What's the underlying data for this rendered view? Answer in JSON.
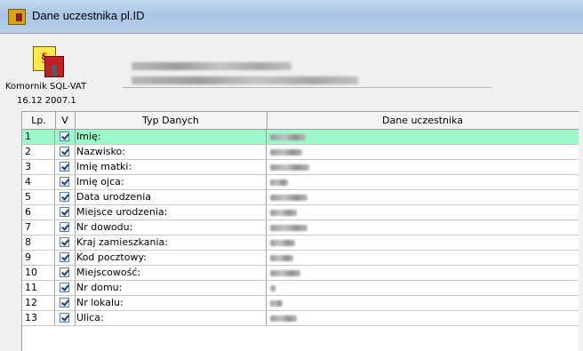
{
  "window": {
    "title": "Dane uczestnika pl.ID"
  },
  "app": {
    "name": "Komornik SQL-VAT",
    "date": "16.12 2007.1"
  },
  "grid": {
    "columns": {
      "lp": "Lp.",
      "v": "V",
      "typ": "Typ Danych",
      "dane": "Dane uczestnika"
    },
    "rows": [
      {
        "lp": "1",
        "typ": "Imię:",
        "checked": true
      },
      {
        "lp": "2",
        "typ": "Nazwisko:",
        "checked": true
      },
      {
        "lp": "3",
        "typ": "Imię matki:",
        "checked": true
      },
      {
        "lp": "4",
        "typ": "Imię ojca:",
        "checked": true
      },
      {
        "lp": "5",
        "typ": "Data urodzenia",
        "checked": true
      },
      {
        "lp": "6",
        "typ": "Miejsce urodzenia:",
        "checked": true
      },
      {
        "lp": "7",
        "typ": "Nr dowodu:",
        "checked": true
      },
      {
        "lp": "8",
        "typ": "Kraj zamieszkania:",
        "checked": true
      },
      {
        "lp": "9",
        "typ": "Kod pocztowy:",
        "checked": true
      },
      {
        "lp": "10",
        "typ": "Miejscowość:",
        "checked": true
      },
      {
        "lp": "11",
        "typ": "Nr domu:",
        "checked": true
      },
      {
        "lp": "12",
        "typ": "Nr lokalu:",
        "checked": true
      },
      {
        "lp": "13",
        "typ": "Ulica:",
        "checked": true
      }
    ]
  },
  "colors": {
    "selected_row": "#9cf8c8",
    "title_bar": "#b7d0ea"
  },
  "icons": {
    "app_icon": "app-icon",
    "logo": "komornik-logo-icon",
    "check": "checkbox-checked-icon"
  }
}
